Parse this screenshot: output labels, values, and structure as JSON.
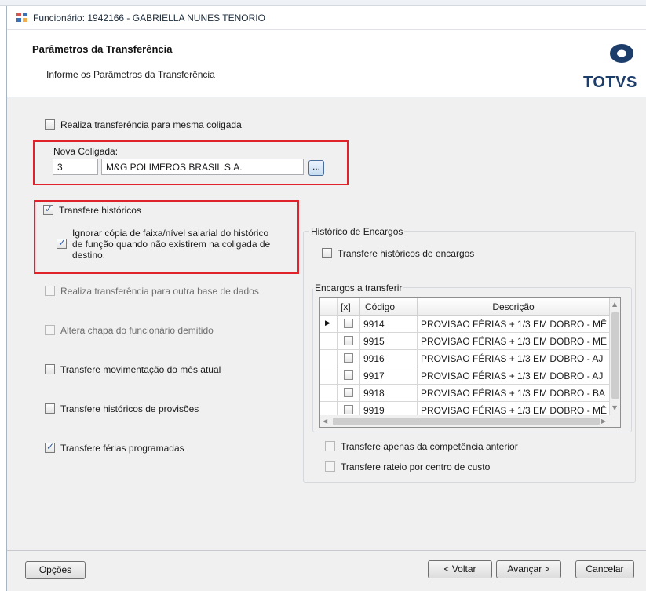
{
  "window": {
    "title": "Funcionário: 1942166 - GABRIELLA NUNES TENORIO"
  },
  "header": {
    "title": "Parâmetros da Transferência",
    "subtitle": "Informe os Parâmetros da Transferência",
    "logo_text": "TOTVS",
    "logo_color": "#1d3d6b"
  },
  "options": {
    "mesma_coligada": {
      "label": "Realiza transferência para mesma coligada",
      "checked": false
    },
    "nova_coligada": {
      "label": "Nova Coligada:",
      "code": "3",
      "name": "M&G POLIMEROS BRASIL S.A.",
      "lookup_label": "..."
    },
    "transfere_historicos": {
      "label": "Transfere históricos",
      "checked": true
    },
    "ignorar_copia": {
      "line1": "Ignorar cópia de faixa/nível salarial do histórico",
      "line2": "de função quando não existirem na coligada de",
      "line3": "destino.",
      "checked": true
    },
    "outra_base": {
      "label": "Realiza transferência para outra base de dados",
      "checked": false,
      "enabled": false
    },
    "altera_chapa": {
      "label": "Altera chapa do funcionário demitido",
      "checked": false,
      "enabled": false
    },
    "movimentacao": {
      "label": "Transfere movimentação do mês atual",
      "checked": false
    },
    "provisoes": {
      "label": "Transfere históricos de provisões",
      "checked": false
    },
    "ferias": {
      "label": "Transfere férias programadas",
      "checked": true
    }
  },
  "encargos": {
    "group_title": "Histórico de Encargos",
    "transfere_label": "Transfere históricos de encargos",
    "sub_group_title": "Encargos a transferir",
    "columns": [
      "[x]",
      "Código",
      "Descrição"
    ],
    "rows": [
      {
        "codigo": "9914",
        "descricao": "PROVISAO FÉRIAS + 1/3 EM DOBRO - MÊ"
      },
      {
        "codigo": "9915",
        "descricao": "PROVISAO FÉRIAS + 1/3 EM DOBRO - ME"
      },
      {
        "codigo": "9916",
        "descricao": "PROVISAO FÉRIAS + 1/3 EM DOBRO - AJ"
      },
      {
        "codigo": "9917",
        "descricao": "PROVISAO FÉRIAS + 1/3 EM DOBRO - AJ"
      },
      {
        "codigo": "9918",
        "descricao": "PROVISAO FÉRIAS + 1/3 EM DOBRO - BA"
      },
      {
        "codigo": "9919",
        "descricao": "PROVISAO FÉRIAS + 1/3 EM DOBRO - MÊ"
      }
    ],
    "competencia_label": "Transfere apenas da competência anterior",
    "rateio_label": "Transfere rateio por centro de custo"
  },
  "footer": {
    "opcoes": "Opções",
    "voltar": "< Voltar",
    "avancar": "Avançar >",
    "cancelar": "Cancelar"
  },
  "colors": {
    "highlight_border": "#e0222a",
    "check_color": "#2a5aa8"
  }
}
